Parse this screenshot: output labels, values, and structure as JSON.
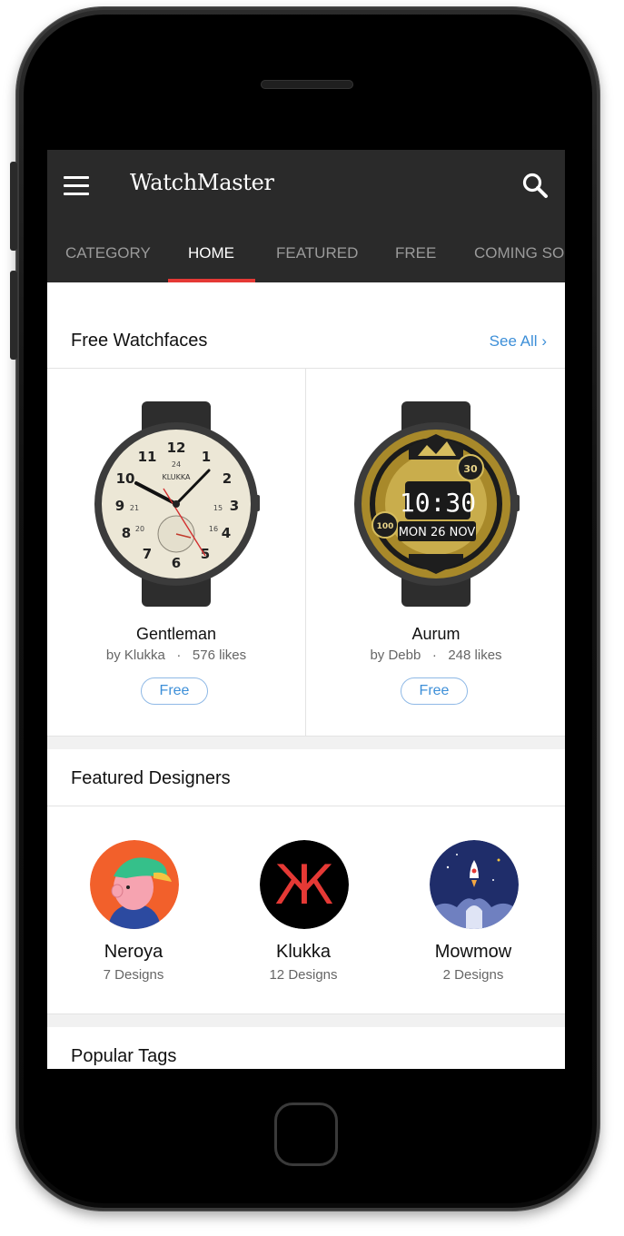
{
  "app": {
    "title": "WatchMaster"
  },
  "tabs": [
    {
      "label": "CATEGORY",
      "active": false
    },
    {
      "label": "HOME",
      "active": true
    },
    {
      "label": "FEATURED",
      "active": false
    },
    {
      "label": "FREE",
      "active": false
    },
    {
      "label": "COMING SO",
      "active": false
    }
  ],
  "free_section": {
    "title": "Free Watchfaces",
    "see_all": "See All",
    "items": [
      {
        "name": "Gentleman",
        "designer": "by Klukka",
        "likes": "576 likes",
        "price": "Free",
        "brand": "KLUKKA"
      },
      {
        "name": "Aurum",
        "designer": "by Debb",
        "likes": "248 likes",
        "price": "Free",
        "time": "10:30",
        "date": "MON 26 NOV",
        "badge_top": "30",
        "badge_left": "100"
      }
    ]
  },
  "designers_section": {
    "title": "Featured Designers",
    "items": [
      {
        "name": "Neroya",
        "count": "7 Designs",
        "avatar": "cartoon-boy-avatar",
        "color": "#f2602b"
      },
      {
        "name": "Klukka",
        "count": "12 Designs",
        "avatar": "klukka-logo-avatar",
        "color": "#000000",
        "glyph": "Ж"
      },
      {
        "name": "Mowmow",
        "count": "2 Designs",
        "avatar": "rocket-night-avatar",
        "color": "#1f2d6a"
      }
    ]
  },
  "tags_section": {
    "title": "Popular Tags"
  },
  "colors": {
    "accent": "#e53935",
    "link": "#3d8fd8",
    "appbar": "#2a2a2a"
  }
}
